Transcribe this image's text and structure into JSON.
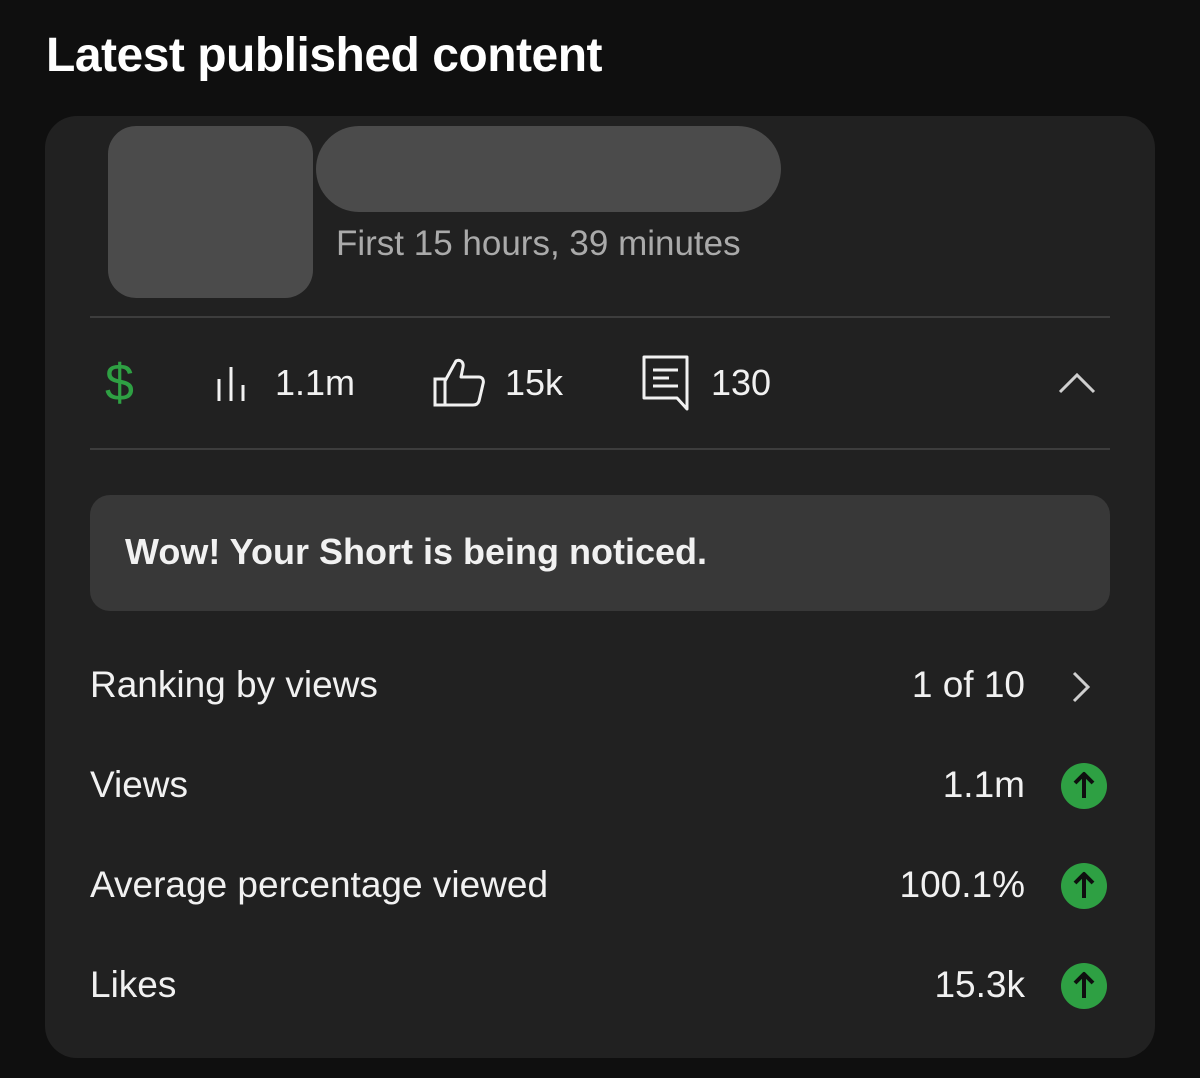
{
  "header": {
    "title": "Latest published content"
  },
  "video": {
    "period": "First 15 hours, 39 minutes"
  },
  "stats": {
    "monetization_icon": "dollar-icon",
    "monetization_symbol": "$",
    "views": "1.1m",
    "likes": "15k",
    "comments": "130"
  },
  "notice": {
    "text": "Wow! Your Short is being noticed."
  },
  "metrics": [
    {
      "label": "Ranking by views",
      "value": "1 of 10",
      "indicator": "chevron-right-icon"
    },
    {
      "label": "Views",
      "value": "1.1m",
      "indicator": "arrow-up-icon"
    },
    {
      "label": "Average percentage viewed",
      "value": "100.1%",
      "indicator": "arrow-up-icon"
    },
    {
      "label": "Likes",
      "value": "15.3k",
      "indicator": "arrow-up-icon"
    }
  ],
  "colors": {
    "background": "#0f0f0f",
    "card": "#212121",
    "accent_green": "#2ea043",
    "notice_bg": "#383838",
    "muted_text": "#aaaaaa"
  }
}
